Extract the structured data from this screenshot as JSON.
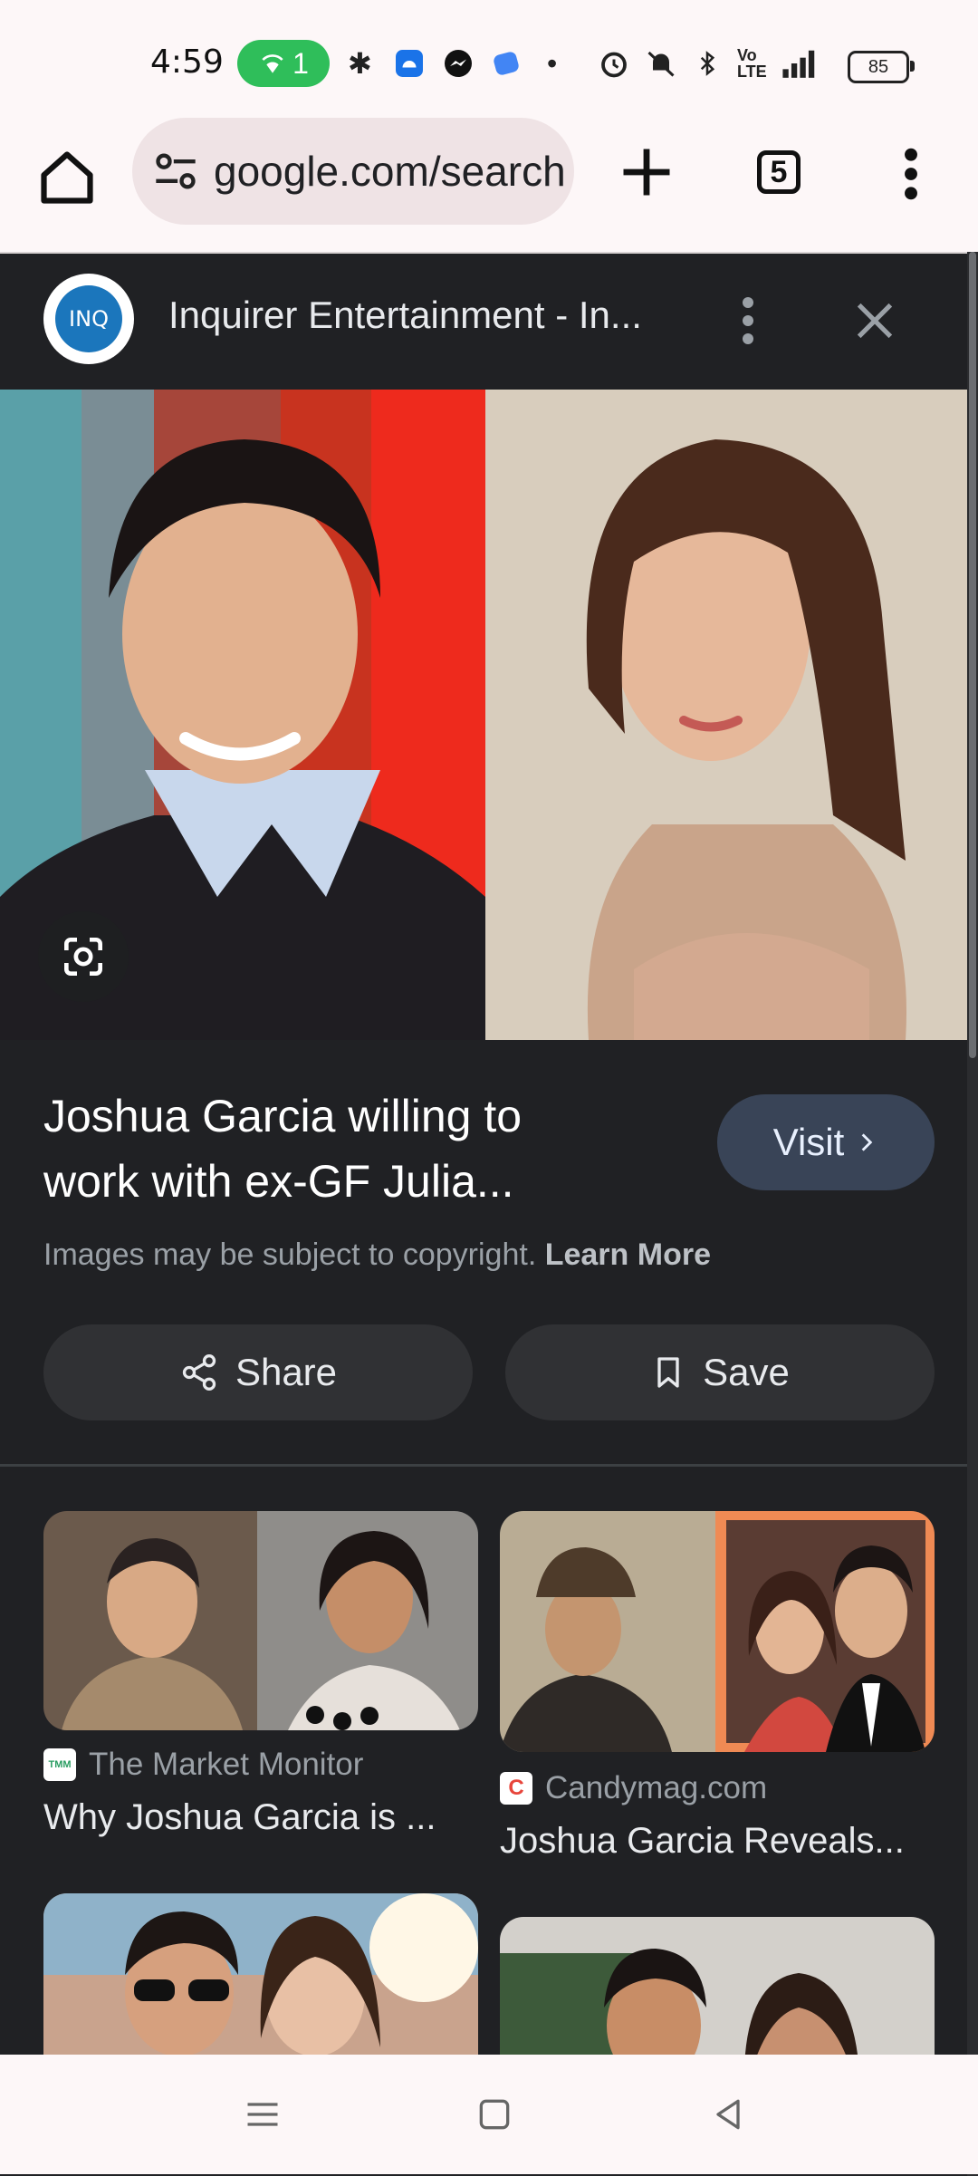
{
  "status_bar": {
    "time": "4:59",
    "wifi_badge": "1",
    "battery": "85",
    "icons": [
      "wifi-hotspot-icon",
      "slack-icon",
      "android-icon",
      "messenger-icon",
      "app-icon",
      "dot-icon",
      "alarm-icon",
      "mute-icon",
      "bluetooth-icon",
      "volte-icon",
      "signal-4g-icon",
      "battery-icon"
    ]
  },
  "toolbar": {
    "url": "google.com/search",
    "tab_count": "5"
  },
  "viewer": {
    "source_logo_text": "INQ",
    "source_title": "Inquirer Entertainment - In...",
    "image_title": "Joshua Garcia willing to work with ex-GF Julia...",
    "visit_label": "Visit",
    "copyright_text": "Images may be subject to copyright.",
    "learn_more": "Learn More",
    "share_label": "Share",
    "save_label": "Save"
  },
  "related": [
    {
      "source": "The Market Monitor",
      "title": "Why Joshua Garcia is ...",
      "favicon_text": "TMM"
    },
    {
      "source": "Candymag.com",
      "title": "Joshua Garcia Reveals...",
      "favicon_text": "C"
    }
  ],
  "colors": {
    "background": "#202124",
    "chrome_bg": "#fdf7f8",
    "visit_bg": "#394457",
    "button_bg": "#303134"
  }
}
